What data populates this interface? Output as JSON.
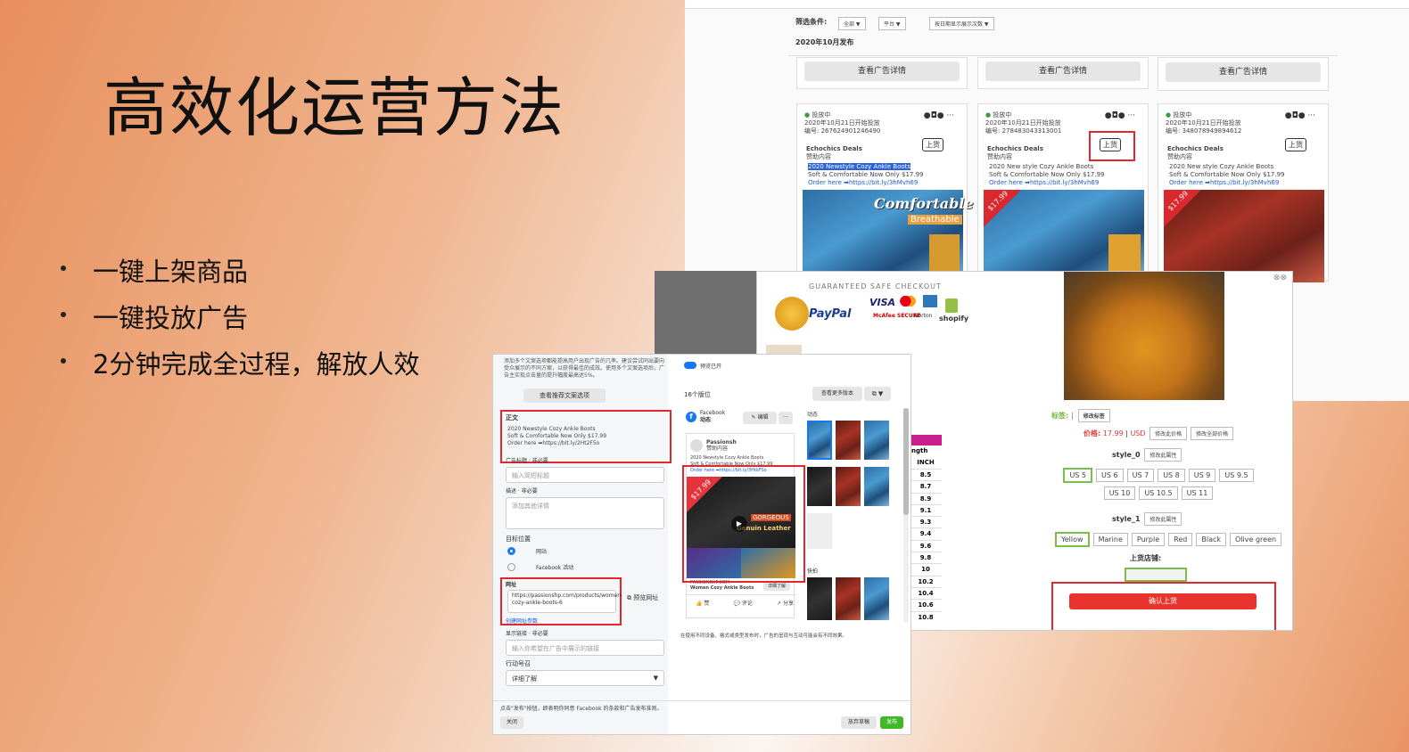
{
  "slide": {
    "title": "高效化运营方法",
    "bullets": [
      "一键上架商品",
      "一键投放广告",
      "2分钟完成全过程，解放人效"
    ]
  },
  "adlib": {
    "filter_label": "筛选条件:",
    "filter_all": "全部 ▼",
    "filter_platform": "平台 ▼",
    "filter_sort": "按日期显示展示次数 ▼",
    "date_header": "2020年10月发布",
    "detail_btn": "查看广告详情",
    "cards": [
      {
        "status": "投放中",
        "date": "2020年10月21日开始投放",
        "id": "编号: 267624901246490",
        "page": "Echochics Deals",
        "sponsored": "赞助内容",
        "badge": "上货",
        "l1": "2020 Newstyle Cozy Ankle Boots",
        "l2": "Soft & Comfortable Now Only $17.99",
        "l3": "Order here ➡https://bit.ly/3hMvh69",
        "img_text1": "Comfortable",
        "img_text2": "Breathable"
      },
      {
        "status": "投放中",
        "date": "2020年10月21日开始投放",
        "id": "编号: 278483043313001",
        "page": "Echochics Deals",
        "sponsored": "赞助内容",
        "badge": "上货",
        "l1": "2020 New style Cozy Ankle Boots",
        "l2": "Soft & Comfortable Now Only $17.99",
        "l3": "Order here ➡https://bit.ly/3hMvh69",
        "price_tag": "$17.99"
      },
      {
        "status": "投放中",
        "date": "2020年10月21日开始投放",
        "id": "编号: 348078949894612",
        "page": "Echochics Deals",
        "sponsored": "赞助内容",
        "badge": "上货",
        "l1": "2020 New style Cozy Ankle Boots",
        "l2": "Soft & Comfortable Now Only $17.99",
        "l3": "Order here ➡https://bit.ly/3hMvh69",
        "price_tag": "$17.99"
      }
    ]
  },
  "product": {
    "checkout": "GUARANTEED SAFE CHECKOUT",
    "paypal": "PayPal",
    "visa": "VISA",
    "shopify": "shopify",
    "mcafee": "McAfee SECURE",
    "norton": "Norton",
    "tag_label": "标签:",
    "tag_btn": "修改标签",
    "price_label": "价格:",
    "price_value": "17.99",
    "price_unit": "USD",
    "price_btn1": "修改此价格",
    "price_btn2": "修改全部价格",
    "style0": "style_0",
    "style0_btn": "修改此属性",
    "sizes": [
      "US 5",
      "US 6",
      "US 7",
      "US 8",
      "US 9",
      "US 9.5",
      "US 10",
      "US 10.5",
      "US 11"
    ],
    "style1": "style_1",
    "style1_btn": "修改此属性",
    "colors": [
      "Yellow",
      "Marine",
      "Purple",
      "Red",
      "Black",
      "Olive green"
    ],
    "shop_label": "上货店铺:",
    "confirm": "确认上货"
  },
  "sizechart": {
    "head1": "ngth",
    "head2": "INCH",
    "rows": [
      "8.5",
      "8.7",
      "8.9",
      "9.1",
      "9.3",
      "9.4",
      "9.6",
      "9.8",
      "10",
      "10.2",
      "10.4",
      "10.6",
      "10.8"
    ]
  },
  "adform": {
    "intro": "添加多个文案选项都能提高用户出现广告的几率。建议尝试同出要向受众展示的不同方案，以获得最佳的成效。使用多个文案选项后，广告主实现点击量的提升幅度最高达5%。",
    "intro_btn": "查看推荐文案选项",
    "body_label": "正文",
    "body_l1": "2020 Newstyle Cozy Ankle Boots",
    "body_l2": "Soft & Comfortable Now Only $17.99",
    "body_l3": "Order here ➡https://bit.ly/2Ht2F5o",
    "headline_label": "广告标题 · 非必要",
    "headline_ph": "输入简短标题",
    "desc_label": "描述 · 非必要",
    "desc_ph": "添加其他详情",
    "dest_label": "目标位置",
    "dest_opt1": "网站",
    "dest_opt2": "Facebook 活动",
    "url_label": "网址",
    "url_value": "https://passionshp.com/products/women-cozy-ankle-boots-6",
    "url_preview": "预览网址",
    "url_params": "创建网址参数",
    "display_label": "显示链接 · 非必要",
    "display_ph": "输入你希望在广告中展示的链接",
    "cta_label": "行动号召",
    "cta_value": "详细了解",
    "preview_toggle": "预览已开",
    "placements": "16个版位",
    "more_btn": "查看更多版本",
    "fb_label": "Facebook",
    "fb_sub": "动态",
    "edit_btn": "✎ 编辑",
    "feed_label": "动态",
    "stories_label": "快拍",
    "post_page": "Passionsh",
    "post_sub": "赞助内容",
    "post_l1": "2020 Newstyle Cozy Ankle Boots",
    "post_l2": "Soft & Comfortable Now Only $17.99",
    "post_l3": "Order here ➡https://bit.ly/3HtkFSo",
    "post_price": "$17.99",
    "post_gorgeous": "GORGEOUS",
    "post_leather": "Genuin Leather",
    "post_domain": "PASSIONSHP.COM",
    "post_name": "Women Cozy Ankle Boots",
    "post_cta": "详细了解",
    "like": "赞",
    "comment": "评论",
    "share": "分享",
    "footer_note": "在使用不同设备、格式或类型发布时，广告的呈现与互动可能会有不同效果。",
    "terms": "点击\"发布\"按钮，即表明你同意 Facebook 的条款和广告发布准则。",
    "close": "关闭",
    "discard": "放弃草稿",
    "publish": "发布"
  }
}
